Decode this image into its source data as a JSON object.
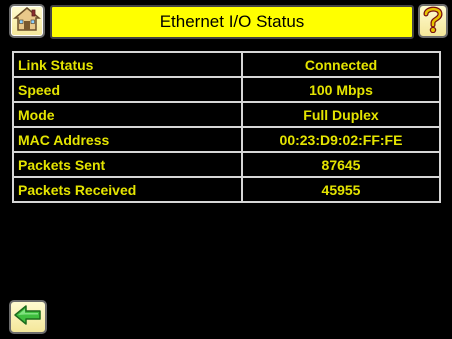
{
  "header": {
    "title": "Ethernet I/O Status",
    "home_icon": "home-icon",
    "help_icon": "question-mark-icon"
  },
  "status_table": {
    "rows": [
      {
        "label": "Link Status",
        "value": "Connected"
      },
      {
        "label": "Speed",
        "value": "100 Mbps"
      },
      {
        "label": "Mode",
        "value": "Full Duplex"
      },
      {
        "label": "MAC Address",
        "value": "00:23:D9:02:FF:FE"
      },
      {
        "label": "Packets Sent",
        "value": "87645"
      },
      {
        "label": "Packets Received",
        "value": "45955"
      }
    ]
  },
  "footer": {
    "back_icon": "back-arrow-icon"
  },
  "colors": {
    "background": "#000000",
    "title_bar": "#ffff00",
    "table_text": "#e4e400",
    "table_border": "#d6d6d6",
    "button_face": "#f4e79a"
  }
}
